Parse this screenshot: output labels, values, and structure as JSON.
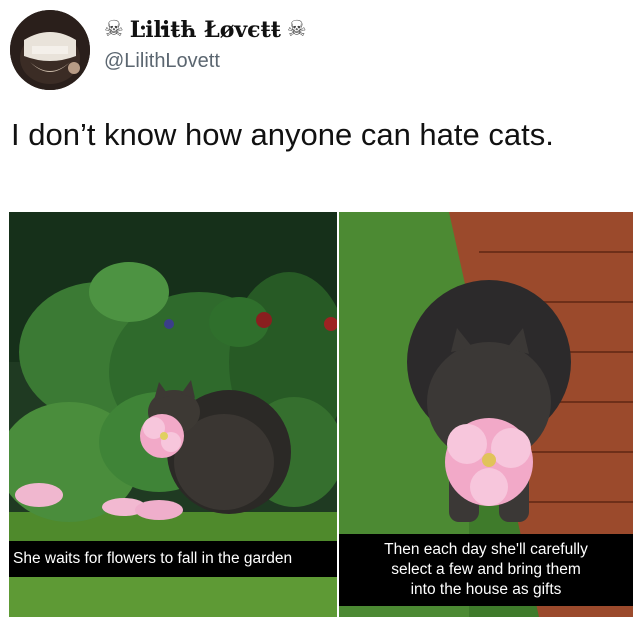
{
  "user": {
    "display_name": "Ŀіŀіŧћ Łøvєŧŧ",
    "handle": "@LilithLovett",
    "avatar_icon": "profile-photo",
    "name_decoration_icon": "skull-crossbones-icon"
  },
  "tweet": {
    "text": "I don’t know how anyone can hate cats."
  },
  "photos": [
    {
      "caption": "She waits for flowers to fall in the garden",
      "scene": "cat-in-garden"
    },
    {
      "caption": "Then each day she'll carefully\nselect a few and bring them\ninto the house as gifts",
      "scene": "cat-carrying-flower"
    }
  ],
  "colors": {
    "handle": "#5b6670",
    "caption_bg": "#000000",
    "caption_text": "#ffffff",
    "flower": "#f2a9c8"
  }
}
